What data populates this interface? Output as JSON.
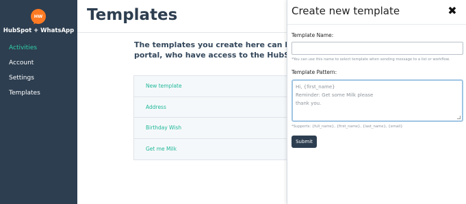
{
  "sidebar": {
    "logo_text": "HW",
    "brand": "HubSpot + WhatsApp",
    "items": [
      {
        "label": "Activities"
      },
      {
        "label": "Account"
      },
      {
        "label": "Settings"
      },
      {
        "label": "Templates"
      }
    ],
    "active_index": 0
  },
  "main": {
    "title": "Templates",
    "description_line1": "The templates you create here can be used",
    "description_line2": "portal, who have access to the HubSpot+W",
    "templates": [
      {
        "label": "New template"
      },
      {
        "label": "Address"
      },
      {
        "label": "Birthday Wish"
      },
      {
        "label": "Get me Milk"
      }
    ]
  },
  "panel": {
    "title": "Create new template",
    "close_icon": "close-icon",
    "name_label": "Template Name:",
    "name_value": "",
    "name_hint": "*You can use this name to select template when sending message to a list or workflow.",
    "pattern_label": "Template Pattern:",
    "pattern_placeholder_lines": [
      "Hi, {first_name}",
      "Reminder: Get some Milk please",
      "thank you."
    ],
    "supports_hint": "*Supports: {full_name}, {first_name}, {last_name}, {email}",
    "submit_label": "Submit"
  },
  "colors": {
    "sidebar_bg": "#2d3e50",
    "accent": "#2fd1a8",
    "logo": "#ff7a22"
  }
}
